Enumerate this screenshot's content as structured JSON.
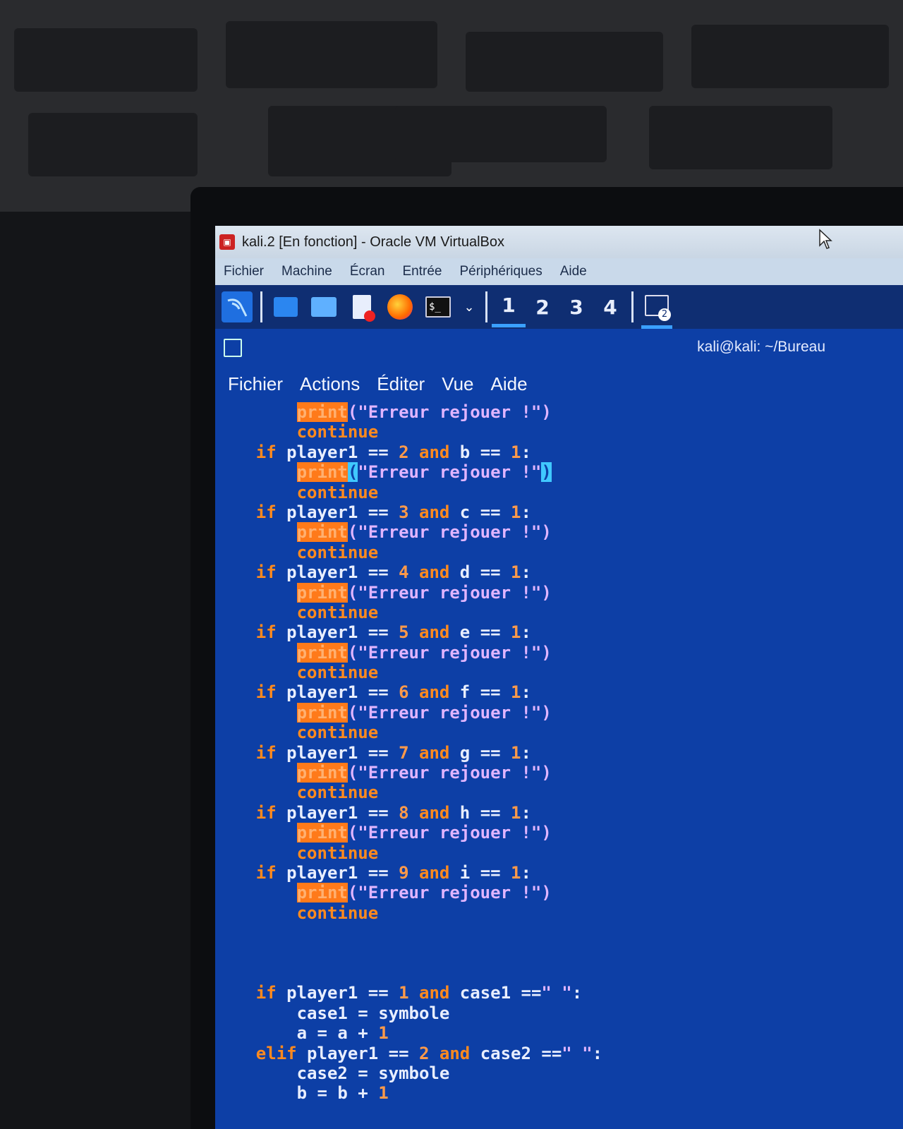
{
  "vbox": {
    "title": "kali.2 [En fonction] - Oracle VM VirtualBox",
    "menu": [
      "Fichier",
      "Machine",
      "Écran",
      "Entrée",
      "Périphériques",
      "Aide"
    ]
  },
  "panel": {
    "workspaces": [
      "1",
      "2",
      "3",
      "4"
    ],
    "active_workspace": "1",
    "icons": [
      "kali-menu-icon",
      "desktop-icon",
      "file-manager-icon",
      "text-editor-icon",
      "firefox-icon",
      "terminal-icon",
      "dropdown-icon",
      "window-switcher-icon"
    ],
    "badge": "2"
  },
  "terminal": {
    "title": "kali@kali: ~/Bureau",
    "menu": [
      "Fichier",
      "Actions",
      "Éditer",
      "Vue",
      "Aide"
    ]
  },
  "code": {
    "print_kw": "print",
    "continue_kw": "continue",
    "msg": "(\"Erreur rejouer !\")",
    "checks": [
      {
        "n": "2",
        "v": "b"
      },
      {
        "n": "3",
        "v": "c"
      },
      {
        "n": "4",
        "v": "d"
      },
      {
        "n": "5",
        "v": "e"
      },
      {
        "n": "6",
        "v": "f"
      },
      {
        "n": "7",
        "v": "g"
      },
      {
        "n": "8",
        "v": "h"
      },
      {
        "n": "9",
        "v": "i"
      }
    ],
    "bottom": [
      {
        "kw": "if",
        "n": "1",
        "case": "case1",
        "var": "a"
      },
      {
        "kw": "elif",
        "n": "2",
        "case": "case2",
        "var": "b"
      }
    ]
  }
}
